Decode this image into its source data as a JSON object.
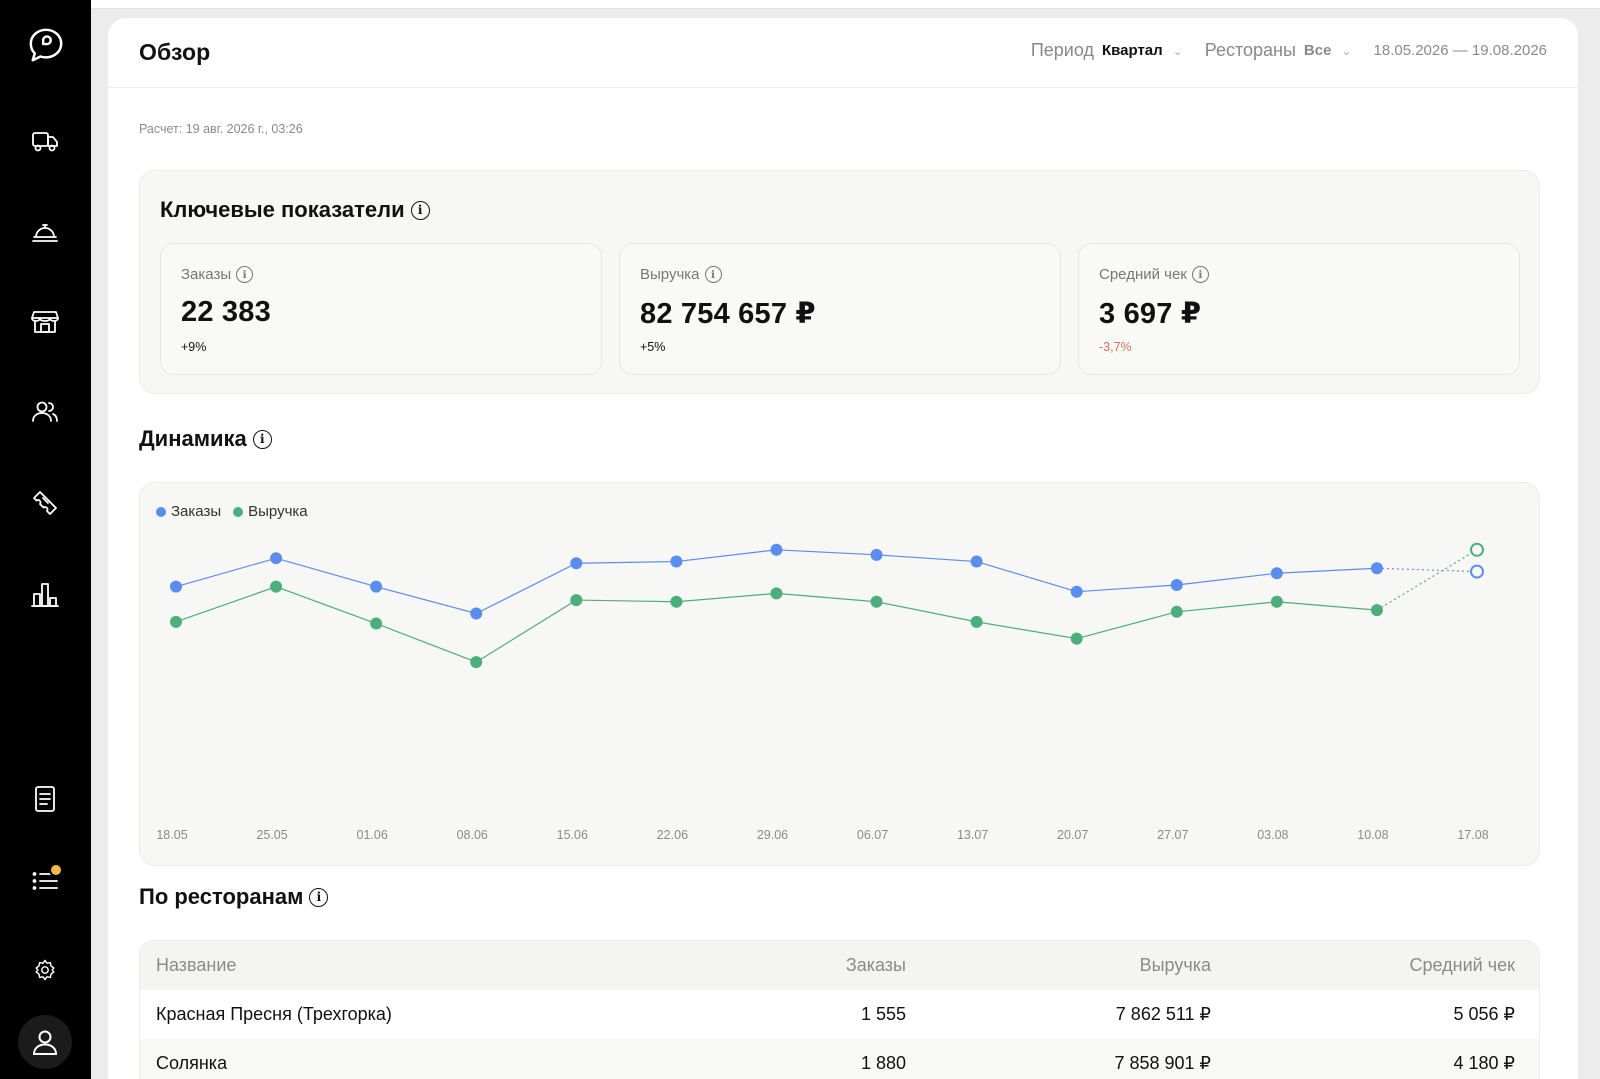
{
  "header": {
    "title": "Обзор",
    "period_label": "Период",
    "period_value": "Квартал",
    "restaurants_label": "Рестораны",
    "restaurants_value": "Все",
    "date_range": "18.05.2026 — 19.08.2026"
  },
  "calc_time": "Расчет: 19 авг. 2026 г., 03:26",
  "kpi": {
    "title": "Ключевые показатели",
    "cards": [
      {
        "label": "Заказы",
        "value": "22 383",
        "delta": "+9%"
      },
      {
        "label": "Выручка",
        "value": "82 754 657 ₽",
        "delta": "+5%"
      },
      {
        "label": "Средний чек",
        "value": "3 697 ₽",
        "delta": "-3,7%"
      }
    ]
  },
  "dynamics": {
    "title": "Динамика",
    "legend": [
      {
        "name": "Заказы",
        "color": "#5b8def"
      },
      {
        "name": "Выручка",
        "color": "#4caf7a"
      }
    ]
  },
  "chart_data": {
    "type": "line",
    "x": [
      "18.05",
      "25.05",
      "01.06",
      "08.06",
      "15.06",
      "22.06",
      "29.06",
      "06.07",
      "13.07",
      "20.07",
      "27.07",
      "03.08",
      "10.08",
      "17.08"
    ],
    "series": [
      {
        "name": "Заказы",
        "values": [
          62,
          79,
          62,
          46,
          76,
          77,
          84,
          81,
          77,
          59,
          63,
          70,
          73,
          71
        ],
        "color": "#5b8def"
      },
      {
        "name": "Выручка",
        "values": [
          41,
          62,
          40,
          17,
          54,
          53,
          58,
          53,
          41,
          31,
          47,
          53,
          48,
          84
        ],
        "color": "#4caf7a"
      }
    ],
    "ylim": [
      -85,
      100
    ],
    "last_point_incomplete": true,
    "grid": false
  },
  "restaurants": {
    "title": "По ресторанам",
    "columns": [
      "Название",
      "Заказы",
      "Выручка",
      "Средний чек"
    ],
    "rows": [
      {
        "name": "Красная Пресня (Трехгорка)",
        "orders": "1 555",
        "revenue": "7 862 511 ₽",
        "avg": "5 056 ₽"
      },
      {
        "name": "Солянка",
        "orders": "1 880",
        "revenue": "7 858 901 ₽",
        "avg": "4 180 ₽"
      }
    ]
  },
  "icons": {
    "logo": "chat-bubble-logo-icon",
    "nav": [
      "truck-icon",
      "cloche-icon",
      "store-icon",
      "users-icon",
      "ticket-icon",
      "bar-chart-icon",
      "document-icon",
      "list-icon",
      "settings-icon",
      "profile-icon"
    ]
  }
}
